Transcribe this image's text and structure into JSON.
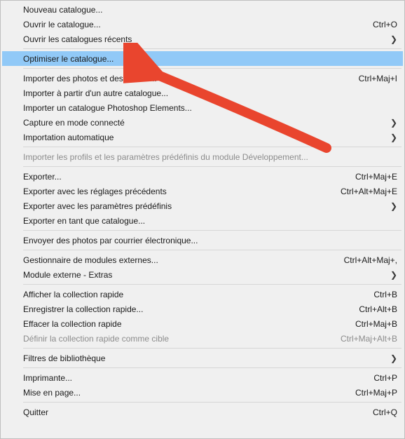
{
  "annotation": {
    "arrow_color": "#e9452e"
  },
  "menu": {
    "groups": [
      [
        {
          "id": "new-catalog",
          "label": "Nouveau catalogue...",
          "shortcut": "",
          "submenu": false,
          "disabled": false,
          "highlighted": false
        },
        {
          "id": "open-catalog",
          "label": "Ouvrir le catalogue...",
          "shortcut": "Ctrl+O",
          "submenu": false,
          "disabled": false,
          "highlighted": false
        },
        {
          "id": "recent-catalogs",
          "label": "Ouvrir les catalogues récents",
          "shortcut": "",
          "submenu": true,
          "disabled": false,
          "highlighted": false
        }
      ],
      [
        {
          "id": "optimize-catalog",
          "label": "Optimiser le catalogue...",
          "shortcut": "",
          "submenu": false,
          "disabled": false,
          "highlighted": true
        }
      ],
      [
        {
          "id": "import-photos",
          "label": "Importer des photos et des vidéos...",
          "shortcut": "Ctrl+Maj+I",
          "submenu": false,
          "disabled": false,
          "highlighted": false
        },
        {
          "id": "import-from-cat",
          "label": "Importer à partir d'un autre catalogue...",
          "shortcut": "",
          "submenu": false,
          "disabled": false,
          "highlighted": false
        },
        {
          "id": "import-pse",
          "label": "Importer un catalogue Photoshop Elements...",
          "shortcut": "",
          "submenu": false,
          "disabled": false,
          "highlighted": false
        },
        {
          "id": "tethered-capture",
          "label": "Capture en mode connecté",
          "shortcut": "",
          "submenu": true,
          "disabled": false,
          "highlighted": false
        },
        {
          "id": "auto-import",
          "label": "Importation automatique",
          "shortcut": "",
          "submenu": true,
          "disabled": false,
          "highlighted": false
        }
      ],
      [
        {
          "id": "import-dev-profiles",
          "label": "Importer les profils et les paramètres prédéfinis du module Développement...",
          "shortcut": "",
          "submenu": false,
          "disabled": true,
          "highlighted": false
        }
      ],
      [
        {
          "id": "export",
          "label": "Exporter...",
          "shortcut": "Ctrl+Maj+E",
          "submenu": false,
          "disabled": false,
          "highlighted": false
        },
        {
          "id": "export-previous",
          "label": "Exporter avec les réglages précédents",
          "shortcut": "Ctrl+Alt+Maj+E",
          "submenu": false,
          "disabled": false,
          "highlighted": false
        },
        {
          "id": "export-presets",
          "label": "Exporter avec les paramètres prédéfinis",
          "shortcut": "",
          "submenu": true,
          "disabled": false,
          "highlighted": false
        },
        {
          "id": "export-as-catalog",
          "label": "Exporter en tant que catalogue...",
          "shortcut": "",
          "submenu": false,
          "disabled": false,
          "highlighted": false
        }
      ],
      [
        {
          "id": "email-photos",
          "label": "Envoyer des photos par courrier électronique...",
          "shortcut": "",
          "submenu": false,
          "disabled": false,
          "highlighted": false
        }
      ],
      [
        {
          "id": "plugin-manager",
          "label": "Gestionnaire de modules externes...",
          "shortcut": "Ctrl+Alt+Maj+,",
          "submenu": false,
          "disabled": false,
          "highlighted": false
        },
        {
          "id": "plugin-extras",
          "label": "Module externe - Extras",
          "shortcut": "",
          "submenu": true,
          "disabled": false,
          "highlighted": false
        }
      ],
      [
        {
          "id": "show-quick",
          "label": "Afficher la collection rapide",
          "shortcut": "Ctrl+B",
          "submenu": false,
          "disabled": false,
          "highlighted": false
        },
        {
          "id": "save-quick",
          "label": "Enregistrer la collection rapide...",
          "shortcut": "Ctrl+Alt+B",
          "submenu": false,
          "disabled": false,
          "highlighted": false
        },
        {
          "id": "clear-quick",
          "label": "Effacer la collection rapide",
          "shortcut": "Ctrl+Maj+B",
          "submenu": false,
          "disabled": false,
          "highlighted": false
        },
        {
          "id": "set-quick-target",
          "label": "Définir la collection rapide comme cible",
          "shortcut": "Ctrl+Maj+Alt+B",
          "submenu": false,
          "disabled": true,
          "highlighted": false
        }
      ],
      [
        {
          "id": "library-filters",
          "label": "Filtres de bibliothèque",
          "shortcut": "",
          "submenu": true,
          "disabled": false,
          "highlighted": false
        }
      ],
      [
        {
          "id": "printer",
          "label": "Imprimante...",
          "shortcut": "Ctrl+P",
          "submenu": false,
          "disabled": false,
          "highlighted": false
        },
        {
          "id": "page-setup",
          "label": "Mise en page...",
          "shortcut": "Ctrl+Maj+P",
          "submenu": false,
          "disabled": false,
          "highlighted": false
        }
      ],
      [
        {
          "id": "quit",
          "label": "Quitter",
          "shortcut": "Ctrl+Q",
          "submenu": false,
          "disabled": false,
          "highlighted": false
        }
      ]
    ]
  }
}
